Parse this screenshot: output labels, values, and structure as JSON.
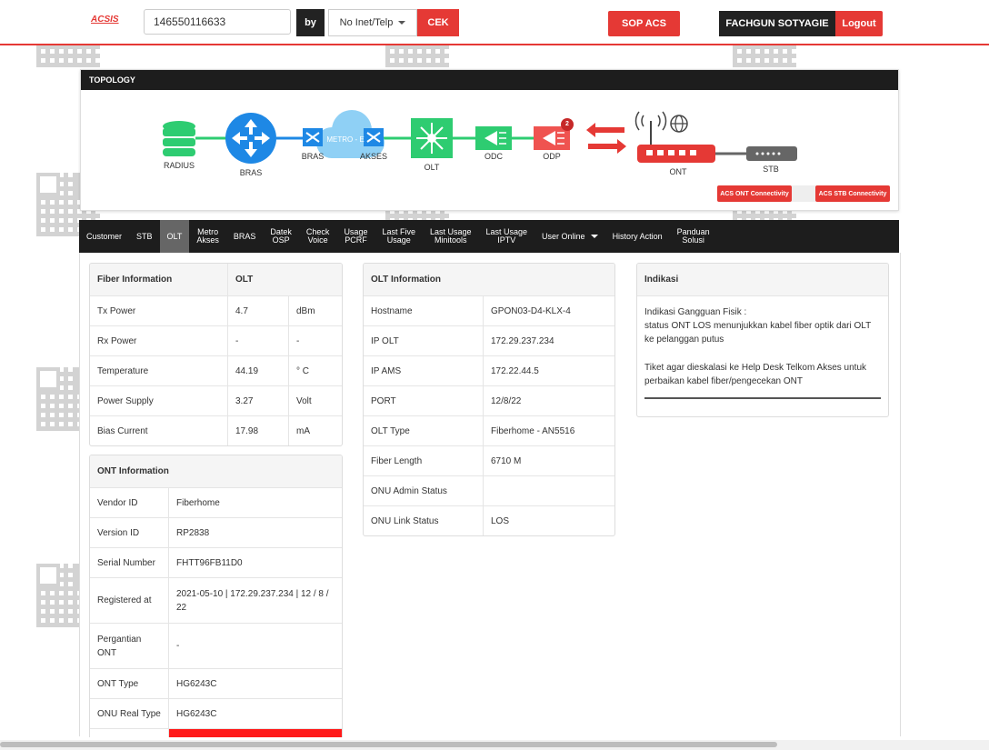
{
  "header": {
    "logo": "ACSIS",
    "search_value": "146550116633",
    "by_label": "by",
    "by_select_value": "No Inet/Telp",
    "cek_button": "CEK",
    "sop_button": "SOP ACS",
    "user_name": "FACHGUN SOTYAGIE",
    "logout_button": "Logout"
  },
  "topology": {
    "title": "TOPOLOGY",
    "nodes": {
      "radius": "RADIUS",
      "bras": "BRAS",
      "bras2": "BRAS",
      "metro": "METRO - E",
      "akses": "AKSES",
      "olt": "OLT",
      "odc": "ODC",
      "odp": "ODP",
      "ont": "ONT",
      "stb": "STB"
    },
    "odp_badge": "2",
    "acs_ont_button": "ACS ONT Connectivity",
    "acs_stb_button": "ACS STB Connectivity",
    "colors": {
      "green": "#2ecc71",
      "blue": "#1e88e5",
      "red": "#e53935",
      "cloud": "#8fd0f5",
      "gray": "#666666"
    }
  },
  "tabs": [
    {
      "l1": "Customer",
      "l2": ""
    },
    {
      "l1": "STB",
      "l2": ""
    },
    {
      "l1": "OLT",
      "l2": ""
    },
    {
      "l1": "Metro",
      "l2": "Akses"
    },
    {
      "l1": "BRAS",
      "l2": ""
    },
    {
      "l1": "Datek",
      "l2": "OSP"
    },
    {
      "l1": "Check",
      "l2": "Voice"
    },
    {
      "l1": "Usage",
      "l2": "PCRF"
    },
    {
      "l1": "Last Five",
      "l2": "Usage"
    },
    {
      "l1": "Last Usage",
      "l2": "Minitools"
    },
    {
      "l1": "Last Usage",
      "l2": "IPTV"
    },
    {
      "l1": "User Online",
      "l2": ""
    },
    {
      "l1": "History Action",
      "l2": ""
    },
    {
      "l1": "Panduan",
      "l2": "Solusi"
    }
  ],
  "fiber": {
    "header": [
      "Fiber Information",
      "OLT"
    ],
    "rows": [
      [
        "Tx Power",
        "4.7",
        "dBm"
      ],
      [
        "Rx Power",
        "-",
        "-"
      ],
      [
        "Temperature",
        "44.19",
        "° C"
      ],
      [
        "Power Supply",
        "3.27",
        "Volt"
      ],
      [
        "Bias Current",
        "17.98",
        "mA"
      ]
    ]
  },
  "ont": {
    "header": "ONT Information",
    "rows": [
      [
        "Vendor ID",
        "Fiberhome"
      ],
      [
        "Version ID",
        "RP2838"
      ],
      [
        "Serial Number",
        "FHTT96FB11D0"
      ],
      [
        "Registered at",
        "2021-05-10 | 172.29.237.234 | 12 / 8 / 22"
      ],
      [
        "Pergantian ONT",
        "-"
      ],
      [
        "ONT Type",
        "HG6243C"
      ],
      [
        "ONU Real Type",
        "HG6243C"
      ]
    ]
  },
  "olt_info": {
    "header": "OLT Information",
    "rows": [
      [
        "Hostname",
        "GPON03-D4-KLX-4"
      ],
      [
        "IP OLT",
        "172.29.237.234"
      ],
      [
        "IP AMS",
        "172.22.44.5"
      ],
      [
        "PORT",
        "12/8/22"
      ],
      [
        "OLT Type",
        "Fiberhome - AN5516"
      ],
      [
        "Fiber Length",
        "6710 M"
      ],
      [
        "ONU Admin Status",
        ""
      ],
      [
        "ONU Link Status",
        "LOS"
      ]
    ]
  },
  "indikasi": {
    "header": "Indikasi",
    "line1": "Indikasi Gangguan Fisik :",
    "line2": "status ONT LOS menunjukkan kabel fiber optik dari OLT ke pelanggan putus",
    "line3": "Tiket agar dieskalasi ke Help Desk Telkom Akses untuk perbaikan kabel fiber/pengecekan ONT"
  }
}
